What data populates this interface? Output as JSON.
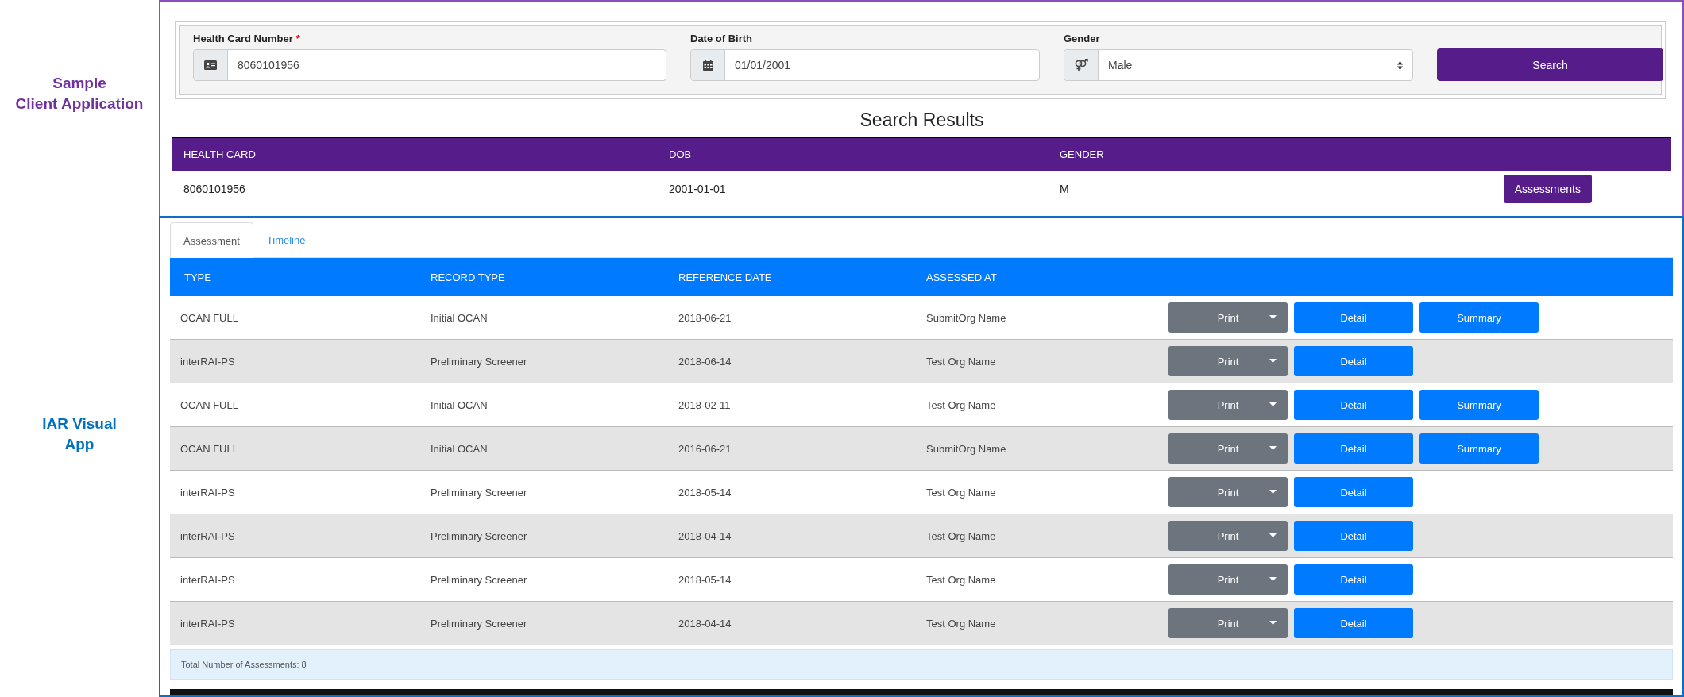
{
  "side_labels": {
    "client": "Sample\nClient Application",
    "visual": "IAR Visual\nApp"
  },
  "search_form": {
    "fields": [
      {
        "kind": "card",
        "label": "Health Card Number",
        "required_mark": "*",
        "value": "8060101956"
      },
      {
        "kind": "date",
        "label": "Date of Birth",
        "value": "01/01/2001"
      },
      {
        "kind": "gender",
        "label": "Gender",
        "value": "Male"
      }
    ],
    "search_button": "Search"
  },
  "search_results": {
    "title": "Search Results",
    "columns": [
      "HEALTH CARD",
      "DOB",
      "GENDER"
    ],
    "rows": [
      {
        "cells": [
          "8060101956",
          "2001-01-01",
          "M"
        ],
        "action": "Assessments"
      }
    ]
  },
  "tabs": [
    {
      "label": "Assessment",
      "selected": true
    },
    {
      "label": "Timeline",
      "selected": false
    }
  ],
  "assessments": {
    "columns": [
      "TYPE",
      "RECORD TYPE",
      "REFERENCE DATE",
      "ASSESSED AT"
    ],
    "rows": [
      {
        "cells": [
          "OCAN FULL",
          "Initial OCAN",
          "2018-06-21",
          "SubmitOrg Name"
        ],
        "actions": [
          {
            "kind": "split",
            "label": "Print"
          },
          {
            "kind": "button",
            "label": "Detail"
          },
          {
            "kind": "button",
            "label": "Summary"
          }
        ]
      },
      {
        "cells": [
          "interRAI-PS",
          "Preliminary Screener",
          "2018-06-14",
          "Test Org Name"
        ],
        "actions": [
          {
            "kind": "split",
            "label": "Print"
          },
          {
            "kind": "button",
            "label": "Detail"
          }
        ]
      },
      {
        "cells": [
          "OCAN FULL",
          "Initial OCAN",
          "2018-02-11",
          "Test Org Name"
        ],
        "actions": [
          {
            "kind": "split",
            "label": "Print"
          },
          {
            "kind": "button",
            "label": "Detail"
          },
          {
            "kind": "button",
            "label": "Summary"
          }
        ]
      },
      {
        "cells": [
          "OCAN FULL",
          "Initial OCAN",
          "2016-06-21",
          "SubmitOrg Name"
        ],
        "actions": [
          {
            "kind": "split",
            "label": "Print"
          },
          {
            "kind": "button",
            "label": "Detail"
          },
          {
            "kind": "button",
            "label": "Summary"
          }
        ]
      },
      {
        "cells": [
          "interRAI-PS",
          "Preliminary Screener",
          "2018-05-14",
          "Test Org Name"
        ],
        "actions": [
          {
            "kind": "split",
            "label": "Print"
          },
          {
            "kind": "button",
            "label": "Detail"
          }
        ]
      },
      {
        "cells": [
          "interRAI-PS",
          "Preliminary Screener",
          "2018-04-14",
          "Test Org Name"
        ],
        "actions": [
          {
            "kind": "split",
            "label": "Print"
          },
          {
            "kind": "button",
            "label": "Detail"
          }
        ]
      },
      {
        "cells": [
          "interRAI-PS",
          "Preliminary Screener",
          "2018-05-14",
          "Test Org Name"
        ],
        "actions": [
          {
            "kind": "split",
            "label": "Print"
          },
          {
            "kind": "button",
            "label": "Detail"
          }
        ]
      },
      {
        "cells": [
          "interRAI-PS",
          "Preliminary Screener",
          "2018-04-14",
          "Test Org Name"
        ],
        "actions": [
          {
            "kind": "split",
            "label": "Print"
          },
          {
            "kind": "button",
            "label": "Detail"
          }
        ]
      }
    ],
    "footer": "Total Number of Assessments: 8"
  }
}
